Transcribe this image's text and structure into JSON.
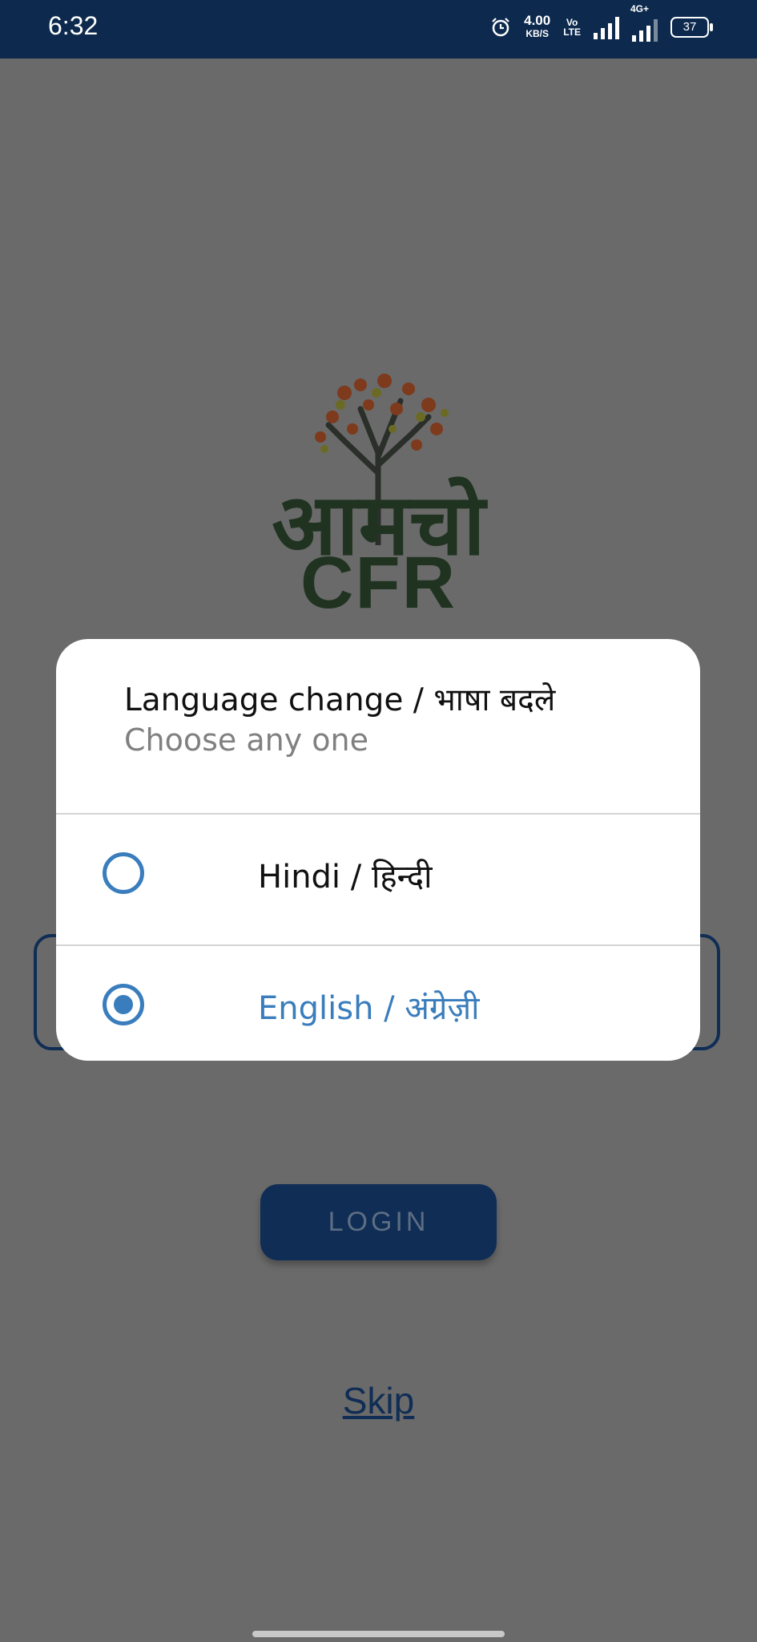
{
  "status_bar": {
    "time": "6:32",
    "network_speed": "4.00",
    "network_speed_unit": "KB/S",
    "volte_label_top": "Vo",
    "volte_label_bottom": "LTE",
    "network_type": "4G+",
    "battery_level": "37"
  },
  "background": {
    "logo_hindi": "आमचो",
    "logo_latin": "CFR",
    "login_label": "LOGIN",
    "skip_label": "Skip"
  },
  "dialog": {
    "title": "Language change / भाषा बदले",
    "subtitle": "Choose any one",
    "options": [
      {
        "label": "Hindi / हिन्दी",
        "selected": false
      },
      {
        "label": "English / अंग्रेज़ी",
        "selected": true
      }
    ]
  },
  "colors": {
    "accent": "#3a7dbd",
    "status_bar": "#0d2a4e",
    "scrim": "#6a6a6a"
  }
}
